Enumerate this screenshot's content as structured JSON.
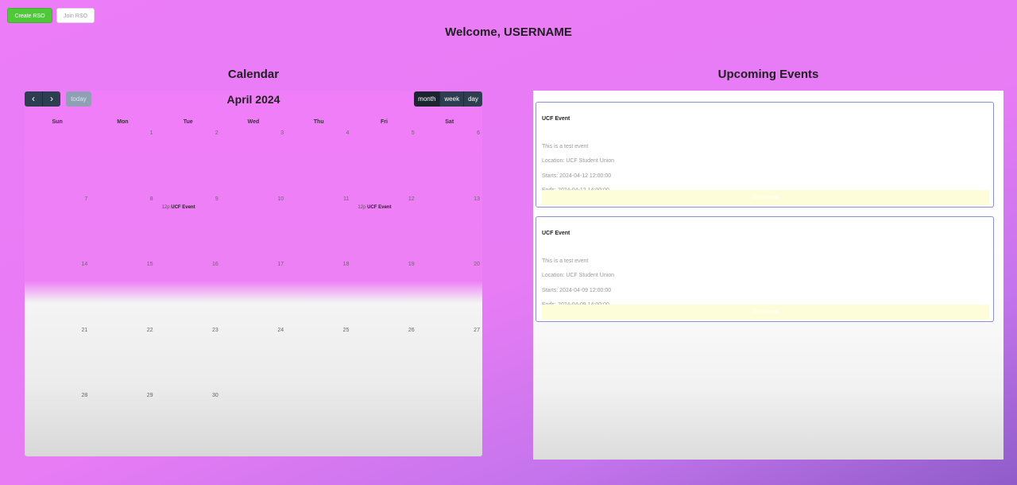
{
  "header": {
    "create_rso": "Create RSO",
    "join_rso": "Join RSO",
    "welcome": "Welcome, USERNAME"
  },
  "calendar": {
    "section_title": "Calendar",
    "month_title": "April 2024",
    "prev_icon": "chevron-left-icon",
    "next_icon": "chevron-right-icon",
    "prev_glyph": "‹",
    "next_glyph": "›",
    "today": "today",
    "views": [
      "month",
      "week",
      "day"
    ],
    "active_view": "month",
    "weekdays": [
      "Sun",
      "Mon",
      "Tue",
      "Wed",
      "Thu",
      "Fri",
      "Sat"
    ],
    "weeks": [
      [
        "",
        "1",
        "2",
        "3",
        "4",
        "5",
        "6"
      ],
      [
        "7",
        "8",
        "9",
        "10",
        "11",
        "12",
        "13"
      ],
      [
        "14",
        "15",
        "16",
        "17",
        "18",
        "19",
        "20"
      ],
      [
        "21",
        "22",
        "23",
        "24",
        "25",
        "26",
        "27"
      ],
      [
        "28",
        "29",
        "30",
        "",
        "",
        "",
        ""
      ]
    ],
    "events": [
      {
        "week": 1,
        "day": 2,
        "time": "12p",
        "title": "UCF Event"
      },
      {
        "week": 1,
        "day": 5,
        "time": "12p",
        "title": "UCF Event"
      }
    ]
  },
  "upcoming": {
    "section_title": "Upcoming Events",
    "cards": [
      {
        "title": "UCF Event",
        "description": "This is a test event",
        "location": "Location: UCF Student Union",
        "starts": "Starts: 2024-04-12 12:00:00",
        "ends": "Ends: 2024-04-12 14:00:00",
        "button": "Join Event"
      },
      {
        "title": "UCF Event",
        "description": "This is a test event",
        "location": "Location: UCF Student Union",
        "starts": "Starts: 2024-04-09 12:00:00",
        "ends": "Ends: 2024-04-09 14:00:00",
        "button": "Join Event"
      }
    ]
  },
  "colors": {
    "create_button": "#4fc93a",
    "calendar_toolbar": "#2c3e50",
    "card_border": "#8b8fd6",
    "card_button": "#fdfdd9"
  }
}
